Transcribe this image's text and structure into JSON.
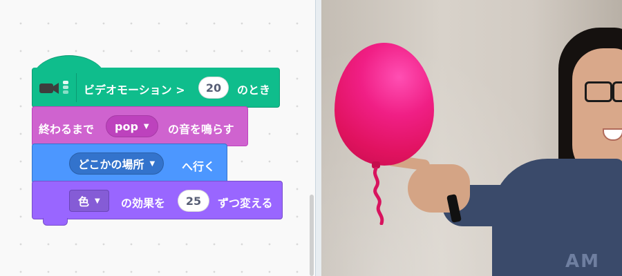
{
  "workspace": {
    "hat_block": {
      "label": "ビデオモーション >",
      "value": "20",
      "suffix": "のとき",
      "icon": "video-sensing-icon"
    },
    "sound_block": {
      "prefix": "終わるまで",
      "sound": "pop",
      "suffix": "の音を鳴らす"
    },
    "motion_block": {
      "target": "どこかの場所",
      "suffix": "へ行く"
    },
    "looks_block": {
      "effect": "色",
      "middle": "の効果を",
      "value": "25",
      "suffix": "ずつ変える"
    }
  },
  "stage": {
    "content": "camera-video-feed",
    "sprite": "balloon"
  },
  "colors": {
    "hat": "#0fbd8c",
    "sound": "#cf63cf",
    "motion": "#4c97ff",
    "looks": "#9966ff",
    "balloon": "#f01f85"
  }
}
